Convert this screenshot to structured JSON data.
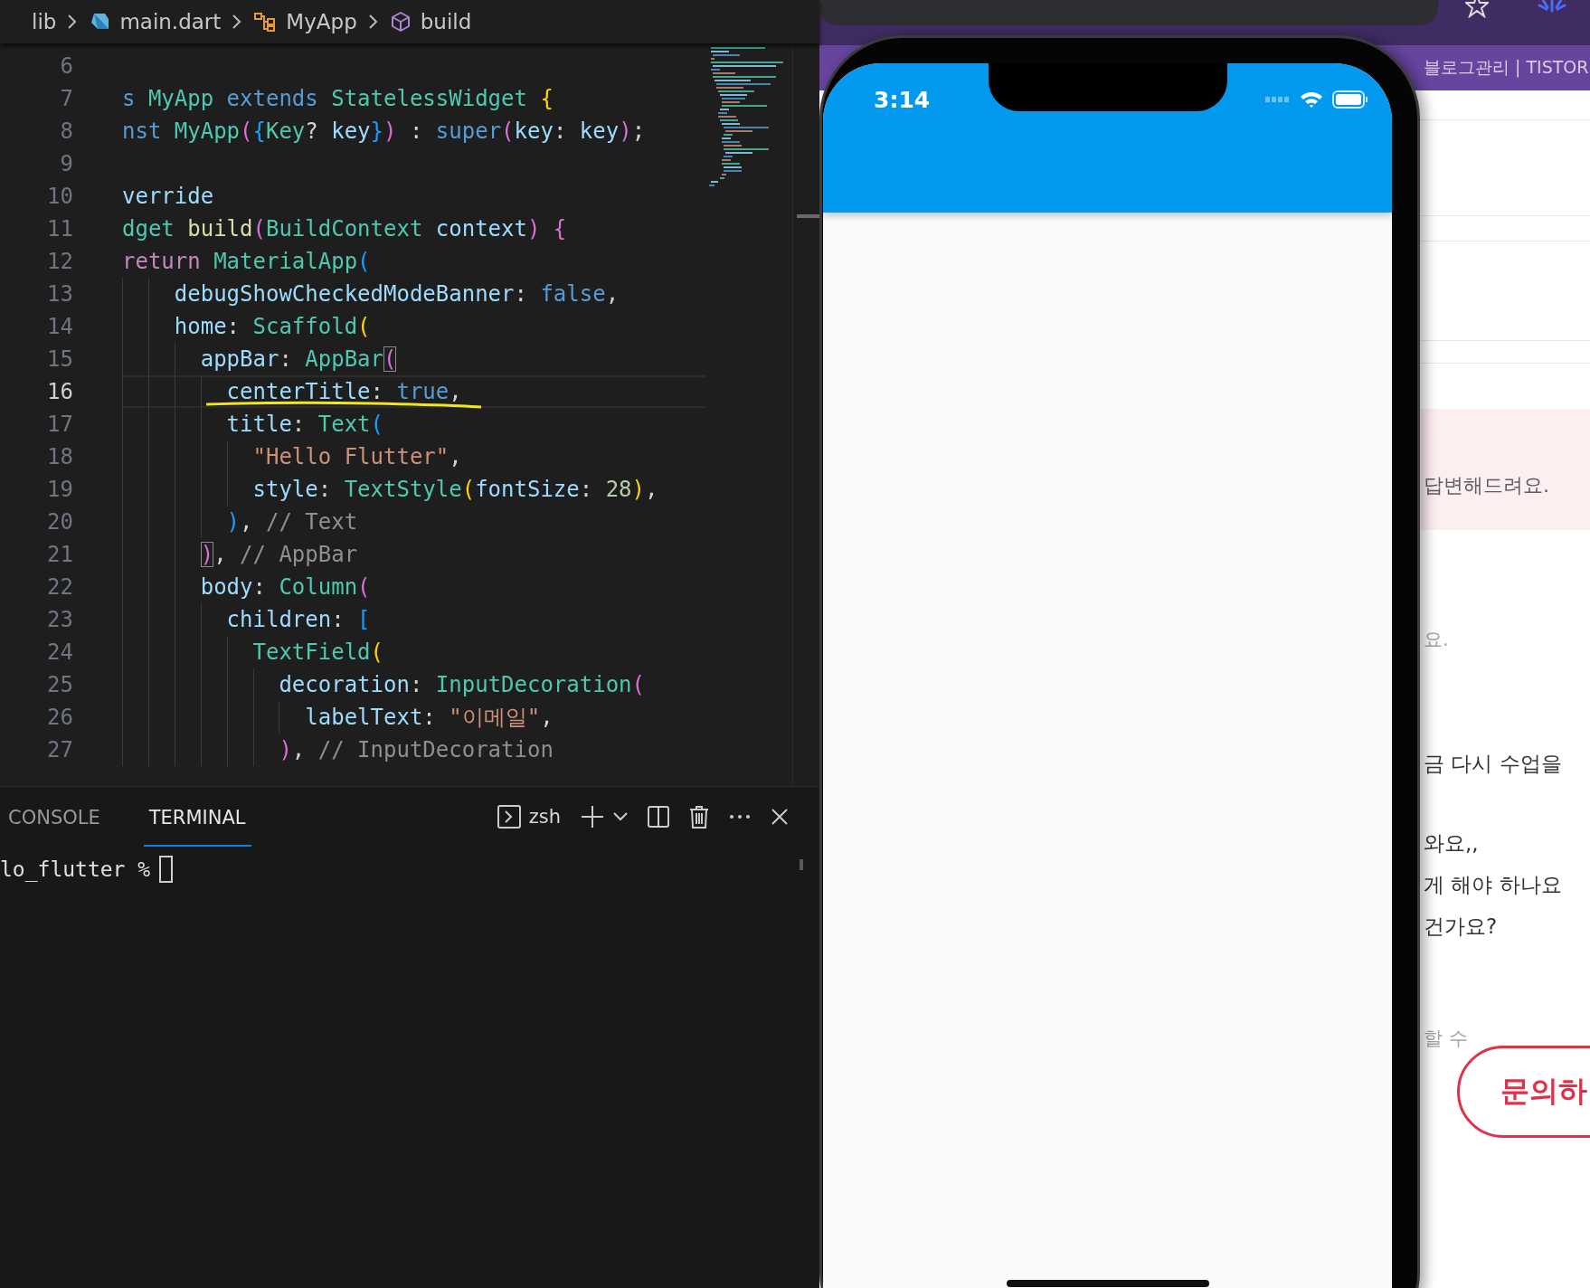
{
  "breadcrumb": [
    {
      "label": "lib",
      "kind": "folder"
    },
    {
      "label": "main.dart",
      "kind": "dart-file"
    },
    {
      "label": "MyApp",
      "kind": "class"
    },
    {
      "label": "build",
      "kind": "method"
    }
  ],
  "code": [
    {
      "number": "6",
      "current": false,
      "underlined": false
    },
    {
      "number": "7",
      "current": false,
      "underlined": false,
      "tokens": [
        {
          "text": "s ",
          "kind": "kw"
        },
        {
          "text": "MyApp ",
          "kind": "type"
        },
        {
          "text": "extends ",
          "kind": "kw"
        },
        {
          "text": "StatelessWidget ",
          "kind": "type"
        },
        {
          "text": "{",
          "kind": "b1"
        }
      ]
    },
    {
      "number": "8",
      "current": false,
      "underlined": false,
      "tokens": [
        {
          "text": "nst ",
          "kind": "kw"
        },
        {
          "text": "MyApp",
          "kind": "type"
        },
        {
          "text": "(",
          "kind": "b2"
        },
        {
          "text": "{",
          "kind": "b3"
        },
        {
          "text": "Key",
          "kind": "type"
        },
        {
          "text": "? ",
          "kind": "plain"
        },
        {
          "text": "key",
          "kind": "var"
        },
        {
          "text": "}",
          "kind": "b3"
        },
        {
          "text": ")",
          "kind": "b2"
        },
        {
          "text": " : ",
          "kind": "plain"
        },
        {
          "text": "super",
          "kind": "kw"
        },
        {
          "text": "(",
          "kind": "b2"
        },
        {
          "text": "key",
          "kind": "var"
        },
        {
          "text": ": ",
          "kind": "plain"
        },
        {
          "text": "key",
          "kind": "var"
        },
        {
          "text": ")",
          "kind": "b2"
        },
        {
          "text": ";",
          "kind": "plain"
        }
      ]
    },
    {
      "number": "9",
      "current": false,
      "underlined": false
    },
    {
      "number": "10",
      "current": false,
      "underlined": false,
      "tokens": [
        {
          "text": "verride",
          "kind": "var"
        }
      ]
    },
    {
      "number": "11",
      "current": false,
      "underlined": false,
      "tokens": [
        {
          "text": "dget ",
          "kind": "type"
        },
        {
          "text": "build",
          "kind": "fn"
        },
        {
          "text": "(",
          "kind": "b2"
        },
        {
          "text": "BuildContext ",
          "kind": "type"
        },
        {
          "text": "context",
          "kind": "var"
        },
        {
          "text": ") ",
          "kind": "b2"
        },
        {
          "text": "{",
          "kind": "b2"
        }
      ]
    },
    {
      "number": "12",
      "current": false,
      "underlined": false,
      "tokens": [
        {
          "text": "return ",
          "kind": "ctrl"
        },
        {
          "text": "MaterialApp",
          "kind": "type"
        },
        {
          "text": "(",
          "kind": "b3"
        }
      ]
    },
    {
      "number": "13",
      "current": false,
      "underlined": false,
      "tokens": [
        {
          "text": "    debugShowCheckedModeBanner",
          "kind": "var"
        },
        {
          "text": ": ",
          "kind": "plain"
        },
        {
          "text": "false",
          "kind": "kw"
        },
        {
          "text": ",",
          "kind": "plain"
        }
      ]
    },
    {
      "number": "14",
      "current": false,
      "underlined": false,
      "tokens": [
        {
          "text": "    home",
          "kind": "var"
        },
        {
          "text": ": ",
          "kind": "plain"
        },
        {
          "text": "Scaffold",
          "kind": "type"
        },
        {
          "text": "(",
          "kind": "b1"
        }
      ]
    },
    {
      "number": "15",
      "current": false,
      "underlined": false,
      "tokens": [
        {
          "text": "      appBar",
          "kind": "var"
        },
        {
          "text": ": ",
          "kind": "plain"
        },
        {
          "text": "AppBar",
          "kind": "type"
        },
        {
          "text": "(",
          "kind": "b2m"
        }
      ]
    },
    {
      "number": "16",
      "current": true,
      "underlined": true,
      "tokens": [
        {
          "text": "        centerTitle",
          "kind": "var"
        },
        {
          "text": ": ",
          "kind": "plain"
        },
        {
          "text": "true",
          "kind": "kw"
        },
        {
          "text": ",",
          "kind": "plain"
        }
      ]
    },
    {
      "number": "17",
      "current": false,
      "underlined": false,
      "tokens": [
        {
          "text": "        title",
          "kind": "var"
        },
        {
          "text": ": ",
          "kind": "plain"
        },
        {
          "text": "Text",
          "kind": "type"
        },
        {
          "text": "(",
          "kind": "b3"
        }
      ]
    },
    {
      "number": "18",
      "current": false,
      "underlined": false,
      "tokens": [
        {
          "text": "          \"Hello Flutter\"",
          "kind": "str"
        },
        {
          "text": ",",
          "kind": "plain"
        }
      ]
    },
    {
      "number": "19",
      "current": false,
      "underlined": false,
      "tokens": [
        {
          "text": "          style",
          "kind": "var"
        },
        {
          "text": ": ",
          "kind": "plain"
        },
        {
          "text": "TextStyle",
          "kind": "type"
        },
        {
          "text": "(",
          "kind": "b1"
        },
        {
          "text": "fontSize",
          "kind": "var"
        },
        {
          "text": ": ",
          "kind": "plain"
        },
        {
          "text": "28",
          "kind": "num"
        },
        {
          "text": ")",
          "kind": "b1"
        },
        {
          "text": ",",
          "kind": "plain"
        }
      ]
    },
    {
      "number": "20",
      "current": false,
      "underlined": false,
      "tokens": [
        {
          "text": "        )",
          "kind": "b3"
        },
        {
          "text": ", ",
          "kind": "plain"
        },
        {
          "text": "// Text",
          "kind": "comment"
        }
      ]
    },
    {
      "number": "21",
      "current": false,
      "underlined": false,
      "tokens": [
        {
          "text": "      )",
          "kind": "b2m"
        },
        {
          "text": ", ",
          "kind": "plain"
        },
        {
          "text": "// AppBar",
          "kind": "comment"
        }
      ]
    },
    {
      "number": "22",
      "current": false,
      "underlined": false,
      "tokens": [
        {
          "text": "      body",
          "kind": "var"
        },
        {
          "text": ": ",
          "kind": "plain"
        },
        {
          "text": "Column",
          "kind": "type"
        },
        {
          "text": "(",
          "kind": "b2"
        }
      ]
    },
    {
      "number": "23",
      "current": false,
      "underlined": false,
      "tokens": [
        {
          "text": "        children",
          "kind": "var"
        },
        {
          "text": ": ",
          "kind": "plain"
        },
        {
          "text": "[",
          "kind": "b3"
        }
      ]
    },
    {
      "number": "24",
      "current": false,
      "underlined": false,
      "tokens": [
        {
          "text": "          TextField",
          "kind": "type"
        },
        {
          "text": "(",
          "kind": "b1"
        }
      ]
    },
    {
      "number": "25",
      "current": false,
      "underlined": false,
      "tokens": [
        {
          "text": "            decoration",
          "kind": "var"
        },
        {
          "text": ": ",
          "kind": "plain"
        },
        {
          "text": "InputDecoration",
          "kind": "type"
        },
        {
          "text": "(",
          "kind": "b2"
        }
      ]
    },
    {
      "number": "26",
      "current": false,
      "underlined": false,
      "tokens": [
        {
          "text": "              labelText",
          "kind": "var"
        },
        {
          "text": ": ",
          "kind": "plain"
        },
        {
          "text": "\"이메일\"",
          "kind": "str"
        },
        {
          "text": ",",
          "kind": "plain"
        }
      ]
    },
    {
      "number": "27",
      "current": false,
      "underlined": false,
      "tokens": [
        {
          "text": "            )",
          "kind": "b2"
        },
        {
          "text": ", ",
          "kind": "plain"
        },
        {
          "text": "// InputDecoration",
          "kind": "comment"
        }
      ]
    }
  ],
  "panel": {
    "tabs": [
      {
        "label": "CONSOLE",
        "selected": false
      },
      {
        "label": "TERMINAL",
        "selected": true
      }
    ],
    "shell": "zsh",
    "prompt": "lo_flutter %"
  },
  "phone": {
    "time": "3:14"
  },
  "browser": {
    "tab_title": "블로그관리 | TISTOR",
    "notice": "답변해드려요.",
    "texts": [
      {
        "text": "요.",
        "kind": "muted"
      },
      {
        "text": "금 다시 수업을",
        "kind": "body"
      },
      {
        "text": "와요,,",
        "kind": "body"
      },
      {
        "text": "게 해야 하나요",
        "kind": "body"
      },
      {
        "text": "건가요?",
        "kind": "body"
      },
      {
        "text": "할 수",
        "kind": "muted"
      }
    ],
    "button": "문의하"
  }
}
